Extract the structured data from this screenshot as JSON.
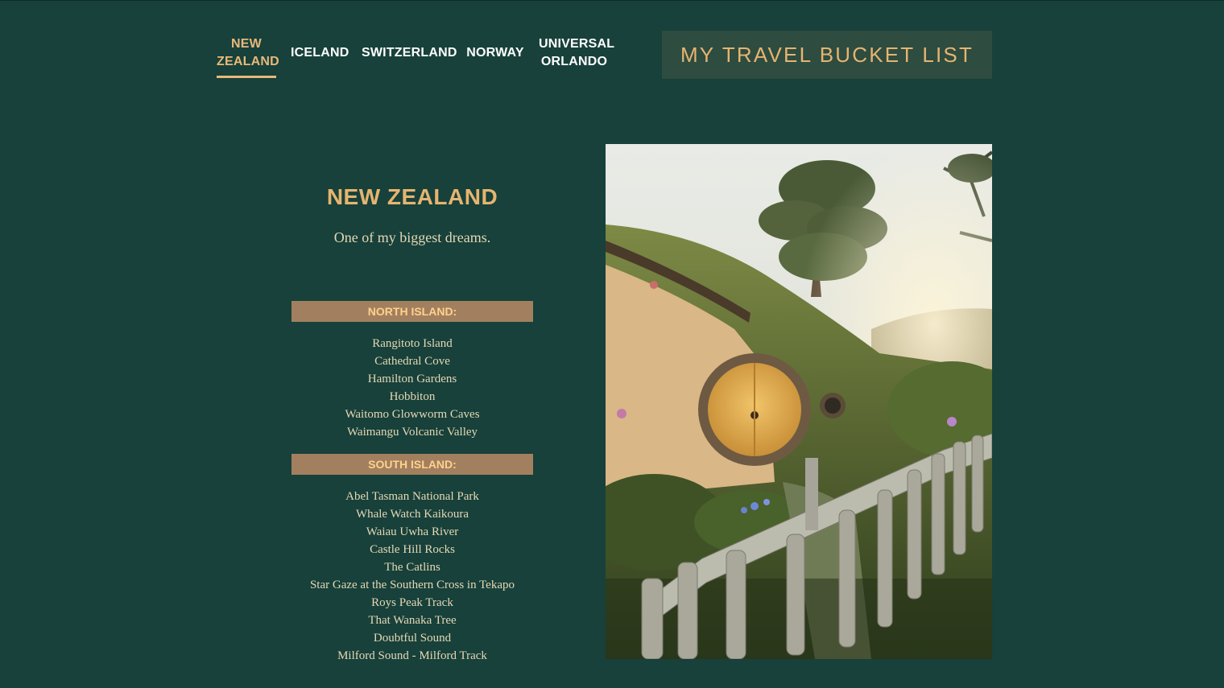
{
  "nav": {
    "items": [
      {
        "label_line1": "NEW",
        "label_line2": "ZEALAND",
        "active": true
      },
      {
        "label": "ICELAND"
      },
      {
        "label": "SWITZERLAND"
      },
      {
        "label": "NORWAY"
      },
      {
        "label_line1": "UNIVERSAL",
        "label_line2": "ORLANDO"
      }
    ]
  },
  "header": {
    "title": "MY TRAVEL BUCKET LIST"
  },
  "main": {
    "heading": "NEW ZEALAND",
    "subheading": "One of my biggest dreams.",
    "north": {
      "title": "NORTH ISLAND:",
      "items": [
        "Rangitoto Island",
        "Cathedral Cove",
        "Hamilton Gardens",
        "Hobbiton",
        "Waitomo Glowworm Caves",
        "Waimangu Volcanic Valley"
      ]
    },
    "south": {
      "title": "SOUTH ISLAND:",
      "items": [
        "Abel Tasman National Park",
        "Whale Watch Kaikoura",
        "Waiau Uwha River",
        "Castle Hill Rocks",
        "The Catlins",
        "Star Gaze at the Southern Cross in Tekapo",
        "Roys Peak Track",
        "That Wanaka Tree",
        "Doubtful Sound",
        "Milford Sound - Milford Track"
      ]
    }
  },
  "colors": {
    "background": "#17413a",
    "accent": "#e6b470",
    "section_bar": "#a2805f",
    "title_box": "#2e4c3f"
  },
  "image": {
    "subject": "hobbit-hole-photo"
  }
}
